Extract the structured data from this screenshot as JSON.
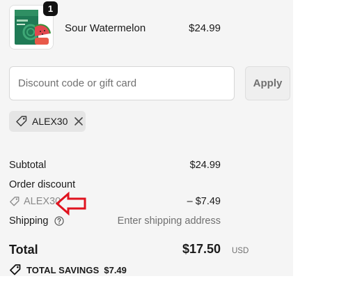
{
  "cart": {
    "item": {
      "name": "Sour Watermelon",
      "price": "$24.99",
      "quantity": "1",
      "thumbnail_icon": "product-box-image"
    }
  },
  "discount": {
    "placeholder": "Discount code or gift card",
    "value": "",
    "apply_label": "Apply",
    "applied_code": "ALEX30"
  },
  "summary": {
    "subtotal_label": "Subtotal",
    "subtotal_value": "$24.99",
    "order_discount_label": "Order discount",
    "order_discount_code": "ALEX30",
    "order_discount_value": "– $7.49",
    "shipping_label": "Shipping",
    "shipping_value": "Enter shipping address",
    "total_label": "Total",
    "currency": "USD",
    "total_value": "$17.50",
    "savings_label": "TOTAL SAVINGS",
    "savings_value": "$7.49"
  },
  "colors": {
    "panel_bg": "#f5f5f5",
    "annotation_arrow": "#e0131f"
  }
}
